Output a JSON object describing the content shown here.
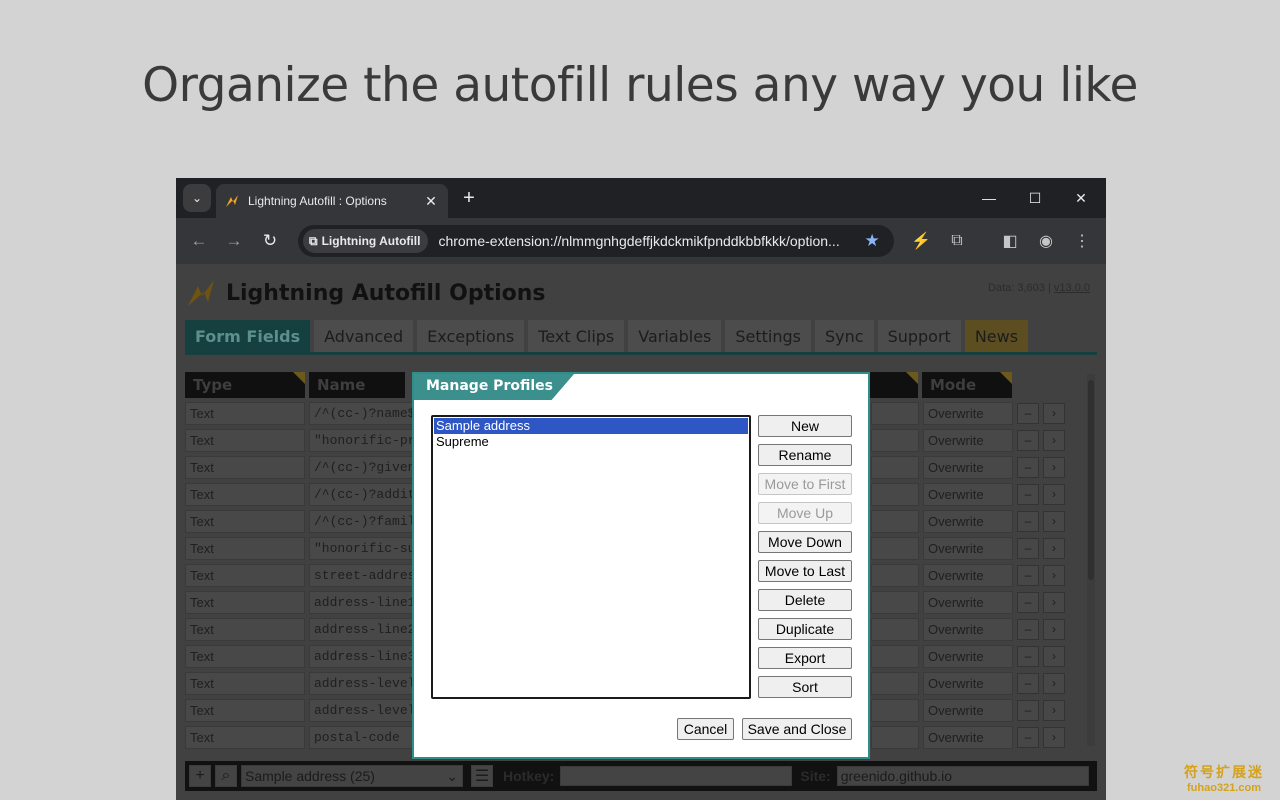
{
  "headline": "Organize the autofill rules any way you like",
  "browser": {
    "tab_title": "Lightning Autofill : Options",
    "chip_label": "Lightning Autofill",
    "url": "chrome-extension://nlmmgnhgdeffjkdckmikfpnddkbbfkkk/option..."
  },
  "app": {
    "title": "Lightning Autofill Options",
    "data_info": "Data: 3,603",
    "separator": "|",
    "version": "v13.0.0",
    "tabs": [
      "Form Fields",
      "Advanced",
      "Exceptions",
      "Text Clips",
      "Variables",
      "Settings",
      "Sync",
      "Support",
      "News"
    ],
    "columns": {
      "type": "Type",
      "name": "Name",
      "mode": "Mode"
    },
    "rows": [
      {
        "type": "Text",
        "name": "/^(cc-)?name$/",
        "mode": "Overwrite"
      },
      {
        "type": "Text",
        "name": "\"honorific-pre",
        "mode": "Overwrite"
      },
      {
        "type": "Text",
        "name": "/^(cc-)?given-",
        "mode": "Overwrite"
      },
      {
        "type": "Text",
        "name": "/^(cc-)?additi",
        "mode": "Overwrite"
      },
      {
        "type": "Text",
        "name": "/^(cc-)?family",
        "mode": "Overwrite"
      },
      {
        "type": "Text",
        "name": "\"honorific-suf",
        "mode": "Overwrite"
      },
      {
        "type": "Text",
        "name": "street-address",
        "mode": "Overwrite"
      },
      {
        "type": "Text",
        "name": "address-line1",
        "mode": "Overwrite"
      },
      {
        "type": "Text",
        "name": "address-line2",
        "mode": "Overwrite"
      },
      {
        "type": "Text",
        "name": "address-line3",
        "mode": "Overwrite"
      },
      {
        "type": "Text",
        "name": "address-level1",
        "mode": "Overwrite"
      },
      {
        "type": "Text",
        "name": "address-level1",
        "mode": "Overwrite"
      },
      {
        "type": "Text",
        "name": "postal-code",
        "mode": "Overwrite"
      }
    ],
    "row_minus": "–",
    "row_arrow": "›",
    "footer": {
      "add": "+",
      "profile_select": "Sample address (25)",
      "hotkey_label": "Hotkey:",
      "hotkey_value": "",
      "site_label": "Site:",
      "site_value": "greenido.github.io"
    }
  },
  "dialog": {
    "title": "Manage Profiles",
    "profiles": [
      {
        "name": "Sample address",
        "selected": true
      },
      {
        "name": "Supreme",
        "selected": false
      }
    ],
    "buttons": [
      {
        "label": "New",
        "enabled": true
      },
      {
        "label": "Rename",
        "enabled": true
      },
      {
        "label": "Move to First",
        "enabled": false
      },
      {
        "label": "Move Up",
        "enabled": false
      },
      {
        "label": "Move Down",
        "enabled": true
      },
      {
        "label": "Move to Last",
        "enabled": true
      },
      {
        "label": "Delete",
        "enabled": true
      },
      {
        "label": "Duplicate",
        "enabled": true
      },
      {
        "label": "Export",
        "enabled": true
      },
      {
        "label": "Sort",
        "enabled": true
      }
    ],
    "cancel": "Cancel",
    "save_close": "Save and Close"
  },
  "watermark": {
    "cn": "符号扩展迷",
    "en": "fuhao321.com"
  }
}
